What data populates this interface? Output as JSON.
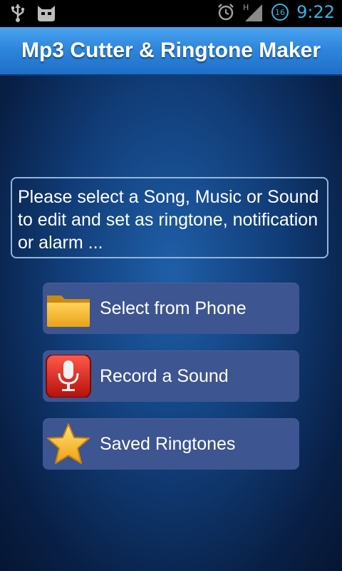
{
  "status_bar": {
    "time": "9:22",
    "notification_count": "16",
    "network_type": "H",
    "icons": [
      "usb-icon",
      "cyanogenmod-icon",
      "alarm-icon",
      "signal-icon",
      "battery-icon"
    ]
  },
  "header": {
    "title": "Mp3 Cutter & Ringtone Maker"
  },
  "main": {
    "prompt": "Please select a Song, Music or Sound to edit and set as ringtone, notification or alarm ...",
    "buttons": [
      {
        "label": "Select from Phone",
        "icon": "folder-icon"
      },
      {
        "label": "Record a Sound",
        "icon": "microphone-icon"
      },
      {
        "label": "Saved Ringtones",
        "icon": "star-icon"
      }
    ]
  },
  "colors": {
    "accent": "#33b5e5",
    "title_bar": "#2f86dd",
    "button_bg": "#3d5590",
    "background": "#113d78"
  }
}
